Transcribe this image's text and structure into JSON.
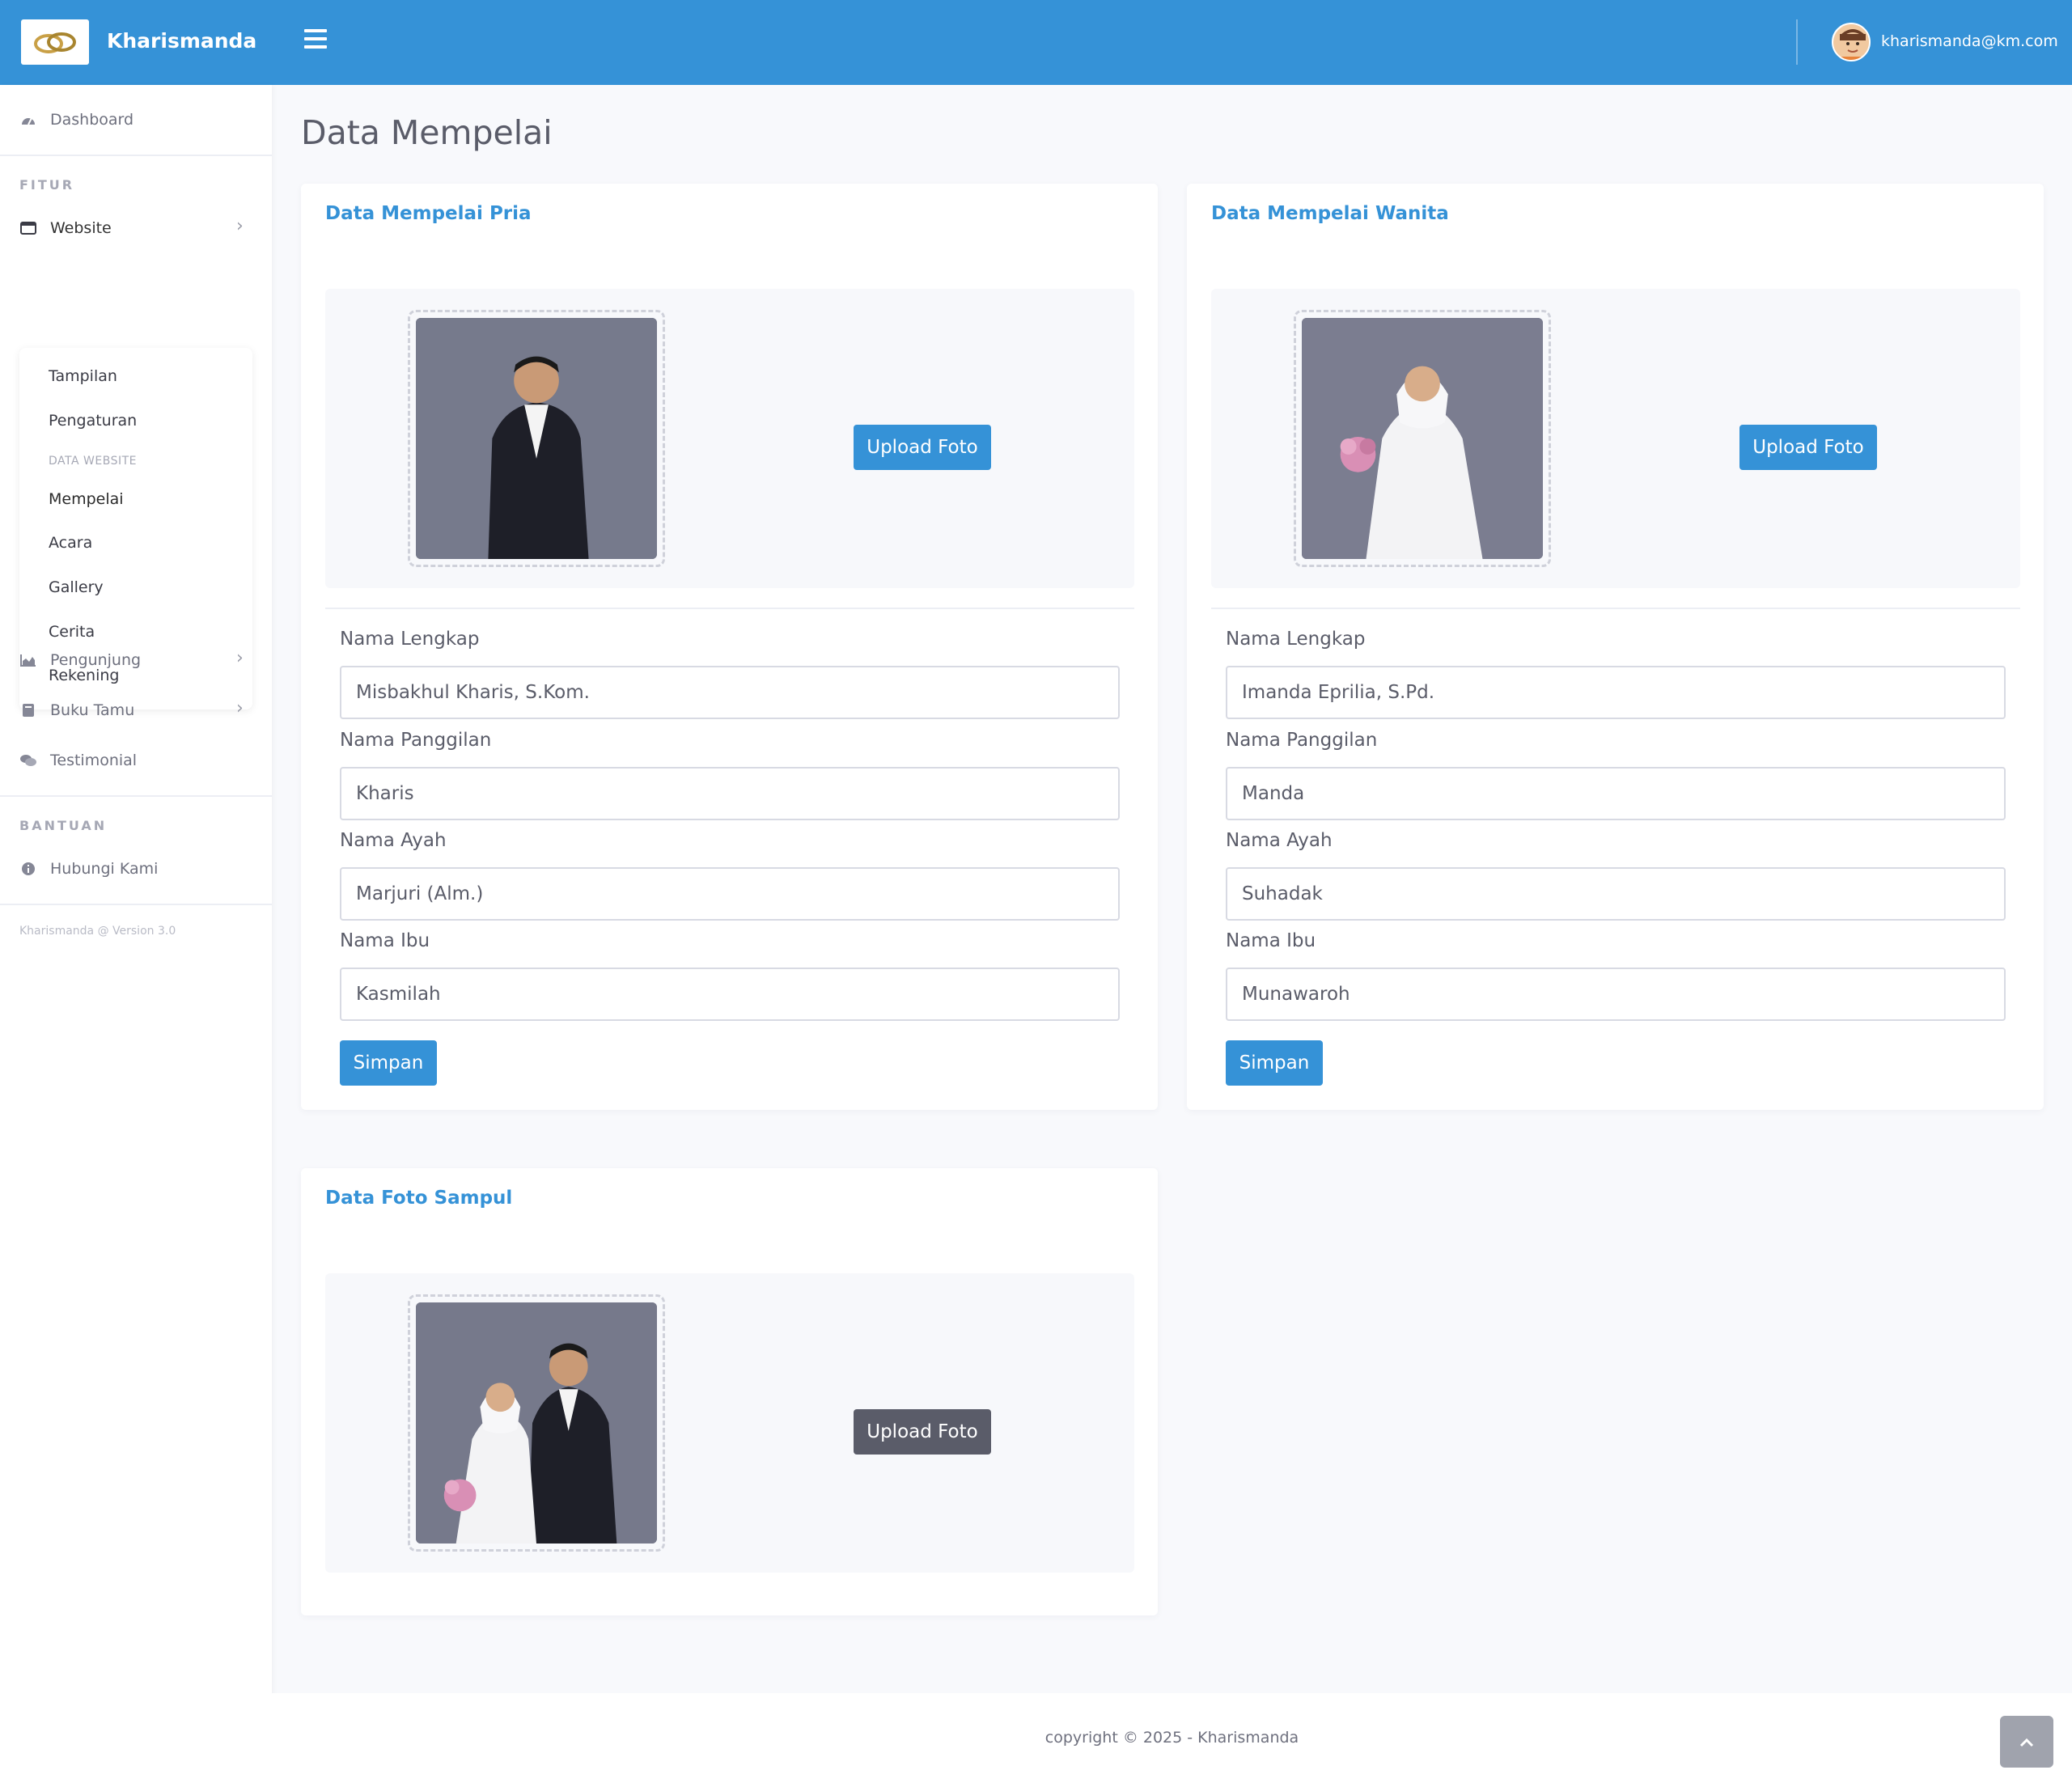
{
  "brand": {
    "name": "Kharismanda"
  },
  "user": {
    "email": "kharismanda@km.com"
  },
  "sidebar": {
    "dashboard": "Dashboard",
    "heading_fitur": "FITUR",
    "website": "Website",
    "submenu": {
      "tampilan": "Tampilan",
      "pengaturan": "Pengaturan",
      "heading": "DATA WEBSITE",
      "mempelai": "Mempelai",
      "acara": "Acara",
      "gallery": "Gallery",
      "cerita": "Cerita",
      "rekening": "Rekening"
    },
    "pengunjung": "Pengunjung",
    "buku_tamu": "Buku Tamu",
    "testimonial": "Testimonial",
    "heading_bantuan": "BANTUAN",
    "hubungi": "Hubungi Kami",
    "version": "Kharismanda @ Version 3.0"
  },
  "page": {
    "title": "Data Mempelai"
  },
  "pria": {
    "title": "Data Mempelai Pria",
    "upload_label": "Upload Foto",
    "nama_lengkap_label": "Nama Lengkap",
    "nama_lengkap": "Misbakhul Kharis, S.Kom.",
    "nama_panggilan_label": "Nama Panggilan",
    "nama_panggilan": "Kharis",
    "nama_ayah_label": "Nama Ayah",
    "nama_ayah": "Marjuri (Alm.)",
    "nama_ibu_label": "Nama Ibu",
    "nama_ibu": "Kasmilah",
    "save_label": "Simpan"
  },
  "wanita": {
    "title": "Data Mempelai Wanita",
    "upload_label": "Upload Foto",
    "nama_lengkap_label": "Nama Lengkap",
    "nama_lengkap": "Imanda Eprilia, S.Pd.",
    "nama_panggilan_label": "Nama Panggilan",
    "nama_panggilan": "Manda",
    "nama_ayah_label": "Nama Ayah",
    "nama_ayah": "Suhadak",
    "nama_ibu_label": "Nama Ibu",
    "nama_ibu": "Munawaroh",
    "save_label": "Simpan"
  },
  "sampul": {
    "title": "Data Foto Sampul",
    "upload_label": "Upload Foto"
  },
  "footer": {
    "copyright": "copyright © 2025 - Kharismanda"
  },
  "colors": {
    "primary": "#3592d7",
    "gray_button": "#5a5c69",
    "background": "#f8f9fc"
  }
}
